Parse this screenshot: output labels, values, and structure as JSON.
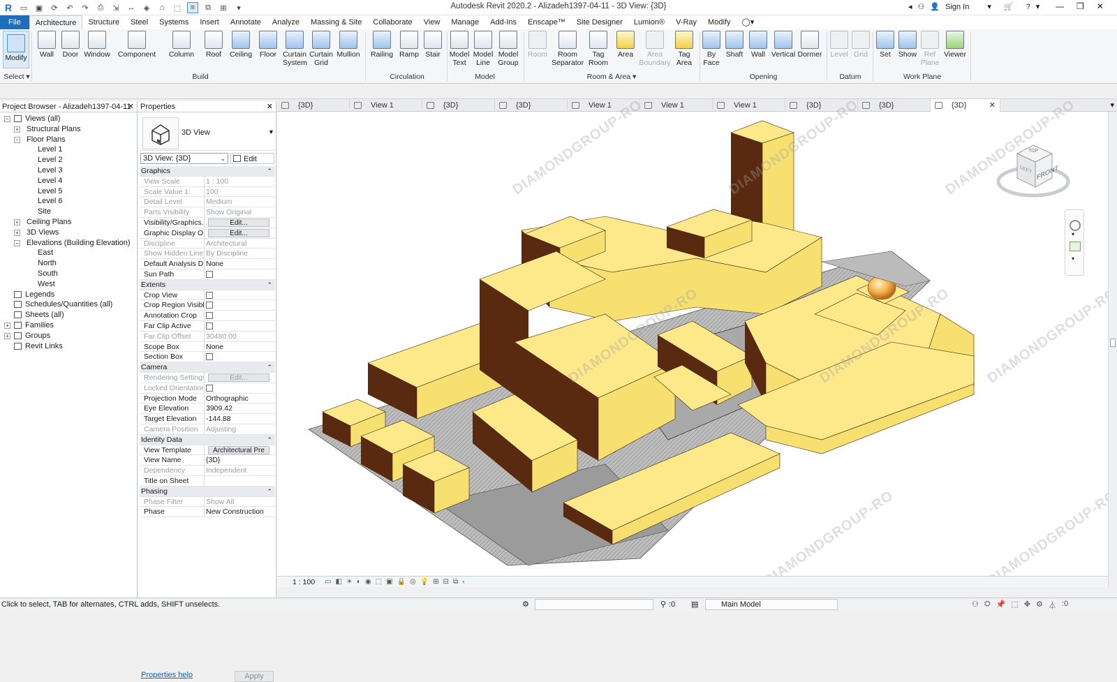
{
  "app": {
    "window_title": "Autodesk Revit 2020.2 - Alizadeh1397-04-11 - 3D View: {3D}",
    "sign_in": "Sign In"
  },
  "ribbon_tabs": [
    "File",
    "Architecture",
    "Structure",
    "Steel",
    "Systems",
    "Insert",
    "Annotate",
    "Analyze",
    "Massing & Site",
    "Collaborate",
    "View",
    "Manage",
    "Add-Ins",
    "Enscape™",
    "Site Designer",
    "Lumion®",
    "V-Ray",
    "Modify"
  ],
  "ribbon": {
    "select": {
      "modify": "Modify",
      "label": "Select ▾"
    },
    "build": {
      "label": "Build",
      "wall": "Wall",
      "door": "Door",
      "window": "Window",
      "component": "Component",
      "column": "Column",
      "roof": "Roof",
      "ceiling": "Ceiling",
      "floor": "Floor",
      "curtain_system": "Curtain System",
      "curtain_grid": "Curtain Grid",
      "mullion": "Mullion"
    },
    "circulation": {
      "label": "Circulation",
      "railing": "Railing",
      "ramp": "Ramp",
      "stair": "Stair"
    },
    "model": {
      "label": "Model",
      "model_text": "Model Text",
      "model_line": "Model Line",
      "model_group": "Model Group"
    },
    "room_area": {
      "label": "Room & Area ▾",
      "room": "Room",
      "room_separator": "Room Separator",
      "tag_room": "Tag Room",
      "area": "Area",
      "area_boundary": "Area Boundary",
      "tag_area": "Tag Area"
    },
    "opening": {
      "label": "Opening",
      "by_face": "By Face",
      "shaft": "Shaft",
      "wall": "Wall",
      "vertical": "Vertical",
      "dormer": "Dormer"
    },
    "datum": {
      "label": "Datum",
      "level": "Level",
      "grid": "Grid"
    },
    "work_plane": {
      "label": "Work Plane",
      "set": "Set",
      "show": "Show",
      "ref_plane": "Ref Plane",
      "viewer": "Viewer"
    }
  },
  "project_browser": {
    "title": "Project Browser - Alizadeh1397-04-11",
    "items": [
      {
        "label": "Views (all)",
        "level": 0,
        "toggle": "−"
      },
      {
        "label": "Structural Plans",
        "level": 1,
        "toggle": "+"
      },
      {
        "label": "Floor Plans",
        "level": 1,
        "toggle": "−"
      },
      {
        "label": "Level 1",
        "level": 2
      },
      {
        "label": "Level 2",
        "level": 2
      },
      {
        "label": "Level 3",
        "level": 2
      },
      {
        "label": "Level 4",
        "level": 2
      },
      {
        "label": "Level 5",
        "level": 2
      },
      {
        "label": "Level 6",
        "level": 2
      },
      {
        "label": "Site",
        "level": 2
      },
      {
        "label": "Ceiling Plans",
        "level": 1,
        "toggle": "+"
      },
      {
        "label": "3D Views",
        "level": 1,
        "toggle": "+"
      },
      {
        "label": "Elevations (Building Elevation)",
        "level": 1,
        "toggle": "−"
      },
      {
        "label": "East",
        "level": 2
      },
      {
        "label": "North",
        "level": 2
      },
      {
        "label": "South",
        "level": 2
      },
      {
        "label": "West",
        "level": 2
      },
      {
        "label": "Legends",
        "level": 0
      },
      {
        "label": "Schedules/Quantities (all)",
        "level": 0
      },
      {
        "label": "Sheets (all)",
        "level": 0
      },
      {
        "label": "Families",
        "level": 0,
        "toggle": "+"
      },
      {
        "label": "Groups",
        "level": 0,
        "toggle": "+"
      },
      {
        "label": "Revit Links",
        "level": 0
      }
    ]
  },
  "properties": {
    "title": "Properties",
    "type_name": "3D View",
    "view_selector": "3D View: {3D}",
    "edit_type": "Edit Type",
    "rows": [
      {
        "section": "Graphics"
      },
      {
        "k": "View Scale",
        "v": "1 : 100",
        "dis": true
      },
      {
        "k": "Scale Value    1:",
        "v": "100",
        "dis": true
      },
      {
        "k": "Detail Level",
        "v": "Medium",
        "dis": true
      },
      {
        "k": "Parts Visibility",
        "v": "Show Original",
        "dis": true
      },
      {
        "k": "Visibility/Graphics...",
        "btn": "Edit..."
      },
      {
        "k": "Graphic Display O...",
        "btn": "Edit..."
      },
      {
        "k": "Discipline",
        "v": "Architectural",
        "dis": true
      },
      {
        "k": "Show Hidden Lines",
        "v": "By Discipline",
        "dis": true
      },
      {
        "k": "Default Analysis D...",
        "v": "None"
      },
      {
        "k": "Sun Path",
        "cb": true
      },
      {
        "section": "Extents"
      },
      {
        "k": "Crop View",
        "cb": true
      },
      {
        "k": "Crop Region Visible",
        "cb": true
      },
      {
        "k": "Annotation Crop",
        "cb": true
      },
      {
        "k": "Far Clip Active",
        "cb": true
      },
      {
        "k": "Far Clip Offset",
        "v": "30480.00",
        "dis": true
      },
      {
        "k": "Scope Box",
        "v": "None"
      },
      {
        "k": "Section Box",
        "cb": true
      },
      {
        "section": "Camera"
      },
      {
        "k": "Rendering Settings",
        "btn": "Edit...",
        "dis": true
      },
      {
        "k": "Locked Orientation",
        "cb": true,
        "dis": true
      },
      {
        "k": "Projection Mode",
        "v": "Orthographic"
      },
      {
        "k": "Eye Elevation",
        "v": "3909.42"
      },
      {
        "k": "Target Elevation",
        "v": "-144.88"
      },
      {
        "k": "Camera Position",
        "v": "Adjusting",
        "dis": true
      },
      {
        "section": "Identity Data"
      },
      {
        "k": "View Template",
        "btn": "Architectural Pre"
      },
      {
        "k": "View Name",
        "v": "{3D}"
      },
      {
        "k": "Dependency",
        "v": "Independent",
        "dis": true
      },
      {
        "k": "Title on Sheet",
        "v": ""
      },
      {
        "section": "Phasing"
      },
      {
        "k": "Phase Filter",
        "v": "Show All",
        "dis": true
      },
      {
        "k": "Phase",
        "v": "New Construction"
      }
    ],
    "help": "Properties help",
    "apply": "Apply"
  },
  "view_tabs": [
    "{3D}",
    "View 1",
    "{3D}",
    "{3D}",
    "View 1",
    "View 1",
    "View 1",
    "{3D}",
    "{3D}",
    "{3D}"
  ],
  "view_bar": {
    "scale": "1 : 100"
  },
  "viewcube": {
    "top": "TOP",
    "front": "FRONT",
    "left": "LEFT"
  },
  "status": {
    "hint": "Click to select, TAB for alternates, CTRL adds, SHIFT unselects.",
    "count": ":0",
    "model": "Main Model",
    "filter": ":0"
  },
  "watermark": "DIAMONDGROUP-RO",
  "colors": {
    "mass_top": "#fde98a",
    "mass_side": "#f7e070",
    "mass_dark": "#5a2a10",
    "accent": "#1e6fb8"
  }
}
